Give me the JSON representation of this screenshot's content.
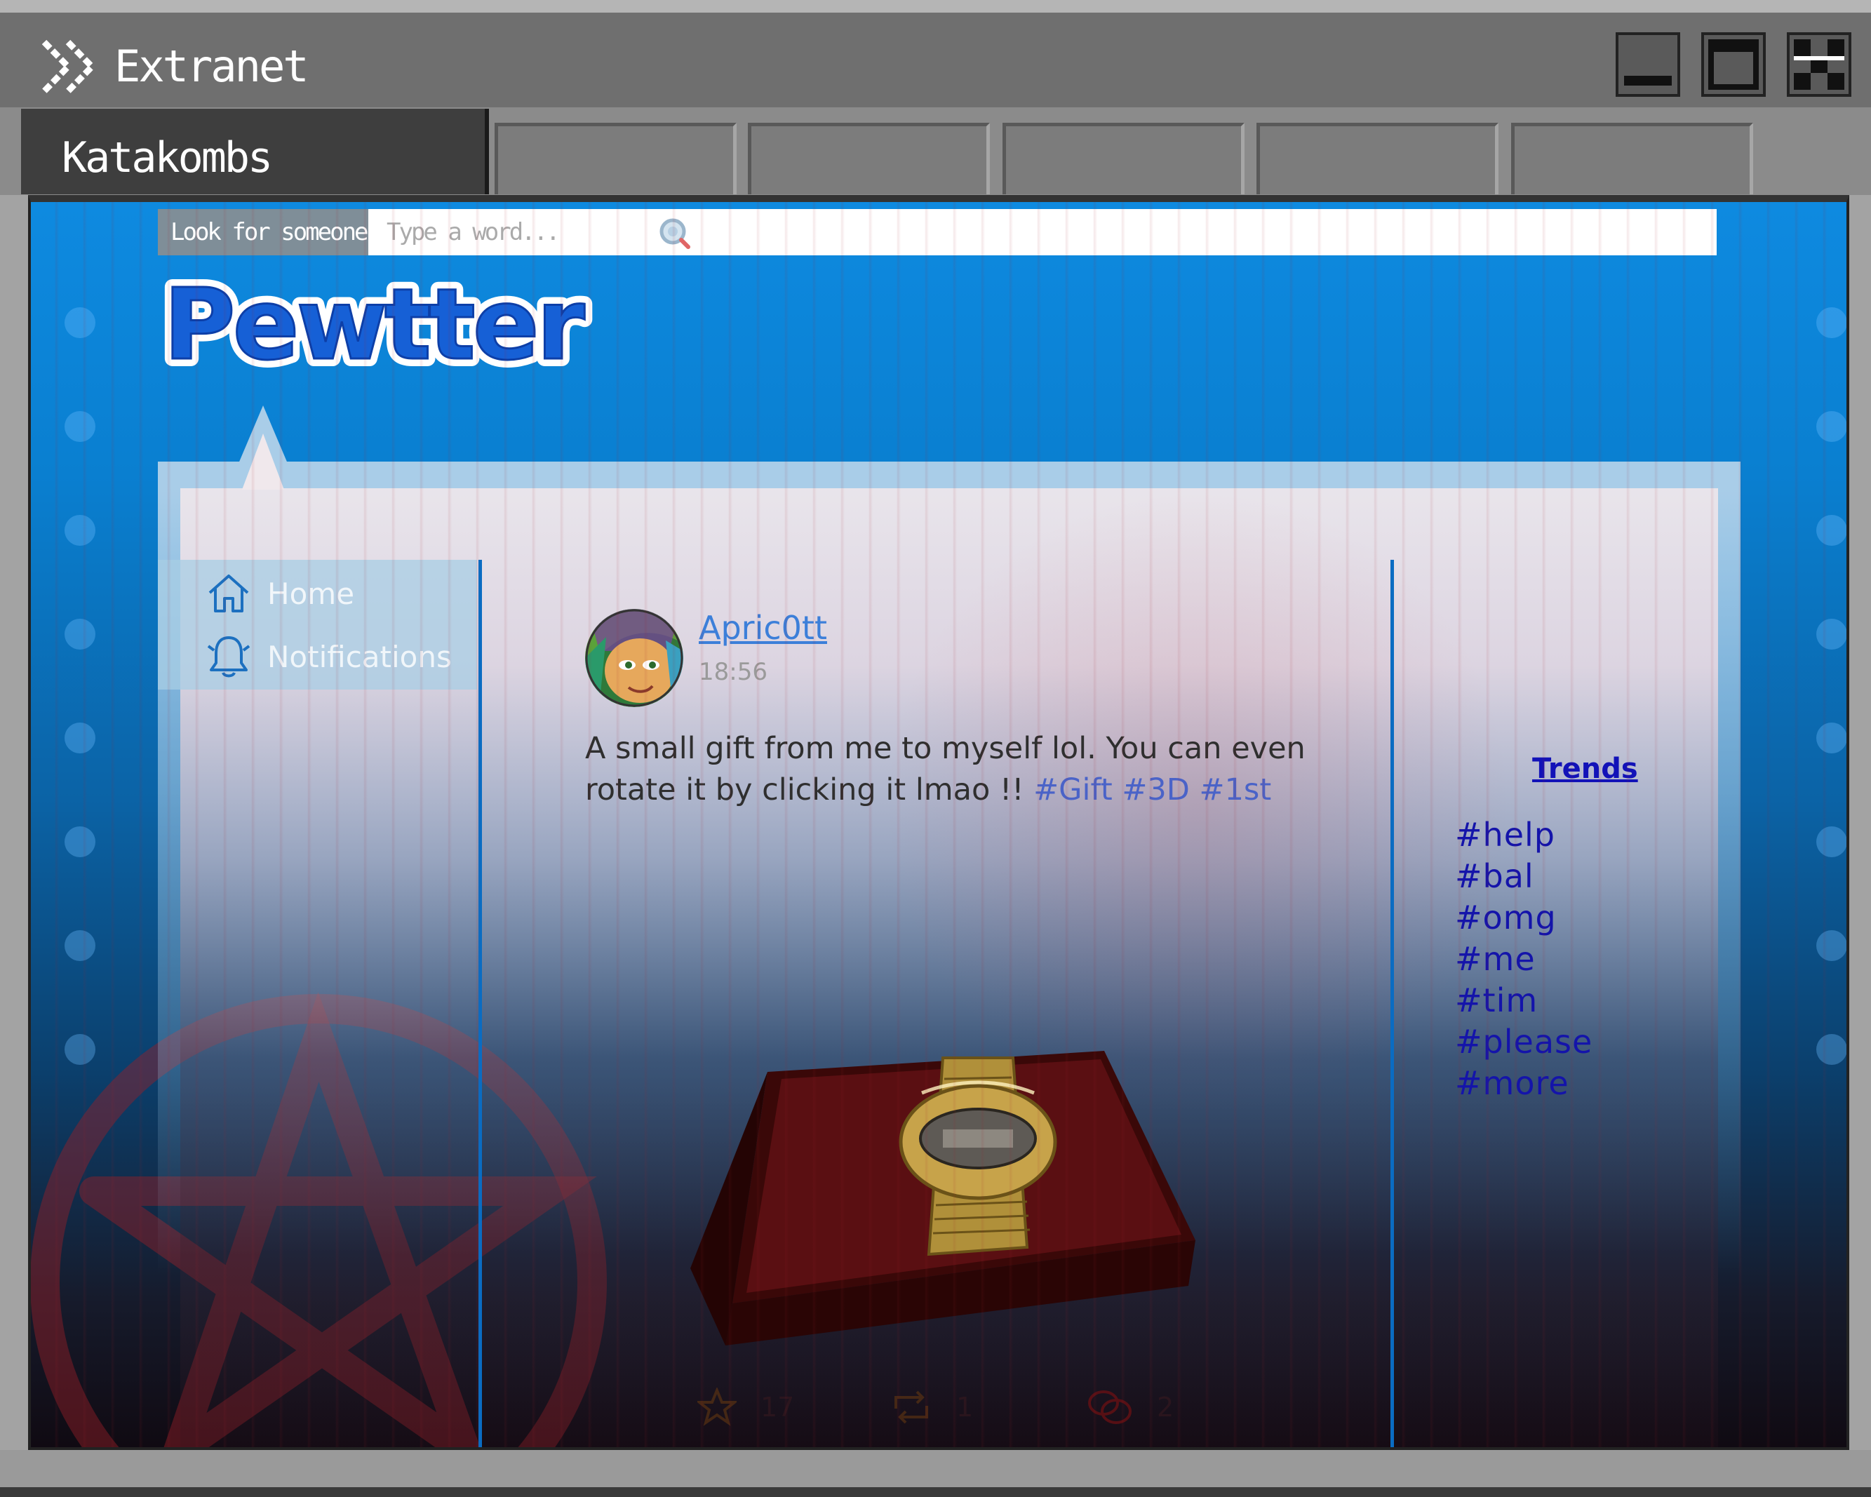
{
  "window": {
    "title": "Extranet",
    "controls": [
      "minimize",
      "maximize",
      "close"
    ]
  },
  "tabs": {
    "active_label": "Katakombs",
    "empty_tab_count": 5
  },
  "search": {
    "button_label": "Look for someone",
    "placeholder": "Type a word..."
  },
  "site": {
    "logo_text": "Pewtter"
  },
  "nav": {
    "home": "Home",
    "notifications": "Notifications"
  },
  "post": {
    "username": "Apric0tt",
    "time": "18:56",
    "text": "A small gift from me to myself lol. You can even rotate it by clicking it lmao !!",
    "hashtags": [
      "#Gift",
      "#3D",
      "#1st"
    ],
    "likes": "17",
    "reposts": "1",
    "replies": "2"
  },
  "trends": {
    "title": "Trends",
    "items": [
      "#help",
      "#bal",
      "#omg",
      "#me",
      "#tim",
      "#please",
      "#more"
    ]
  },
  "colors": {
    "titlebar": "#6f6f6f",
    "viewport_top": "#0e8ae0",
    "link": "#3c7fd9",
    "hashtag": "#4a63c8",
    "trend": "#1414aa",
    "nav_panel": "#a8cde4"
  }
}
